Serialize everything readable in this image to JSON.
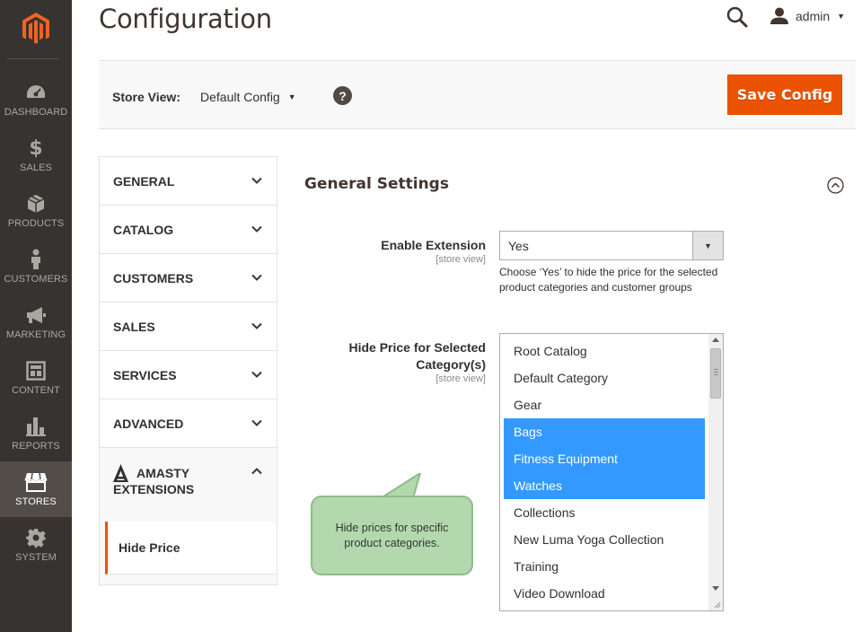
{
  "nav": {
    "items": [
      {
        "label": "DASHBOARD",
        "icon": "dashboard-icon"
      },
      {
        "label": "SALES",
        "icon": "dollar-icon"
      },
      {
        "label": "PRODUCTS",
        "icon": "box-icon"
      },
      {
        "label": "CUSTOMERS",
        "icon": "person-icon"
      },
      {
        "label": "MARKETING",
        "icon": "megaphone-icon"
      },
      {
        "label": "CONTENT",
        "icon": "layout-icon"
      },
      {
        "label": "REPORTS",
        "icon": "bar-chart-icon"
      },
      {
        "label": "STORES",
        "icon": "storefront-icon",
        "active": true
      },
      {
        "label": "SYSTEM",
        "icon": "gear-icon"
      }
    ]
  },
  "header": {
    "title": "Configuration",
    "user": "admin"
  },
  "store_bar": {
    "label": "Store View:",
    "value": "Default Config",
    "help": "?",
    "save_label": "Save Config"
  },
  "tabs": {
    "items": [
      "GENERAL",
      "CATALOG",
      "CUSTOMERS",
      "SALES",
      "SERVICES",
      "ADVANCED"
    ],
    "amasty_line1": "AMASTY",
    "amasty_line2": "EXTENSIONS",
    "subtab": "Hide Price"
  },
  "section": {
    "title": "General Settings",
    "enable": {
      "label": "Enable Extension",
      "scope": "[store view]",
      "value": "Yes",
      "note": "Choose ‘Yes’ to hide the price for the selected product categories and customer groups"
    },
    "categories": {
      "label_line1": "Hide Price for Selected",
      "label_line2": "Category(s)",
      "scope": "[store view]",
      "options": [
        {
          "label": "Root Catalog",
          "selected": false
        },
        {
          "label": "Default Category",
          "selected": false
        },
        {
          "label": "Gear",
          "selected": false
        },
        {
          "label": "Bags",
          "selected": true
        },
        {
          "label": "Fitness Equipment",
          "selected": true
        },
        {
          "label": "Watches",
          "selected": true
        },
        {
          "label": "Collections",
          "selected": false
        },
        {
          "label": "New Luma Yoga Collection",
          "selected": false
        },
        {
          "label": "Training",
          "selected": false
        },
        {
          "label": "Video Download",
          "selected": false
        }
      ]
    }
  },
  "callout": {
    "text": "Hide prices for specific product categories."
  },
  "colors": {
    "nav_bg": "#373330",
    "accent": "#eb5202",
    "selection": "#3399ff",
    "callout_bg": "#b3d8ae"
  }
}
